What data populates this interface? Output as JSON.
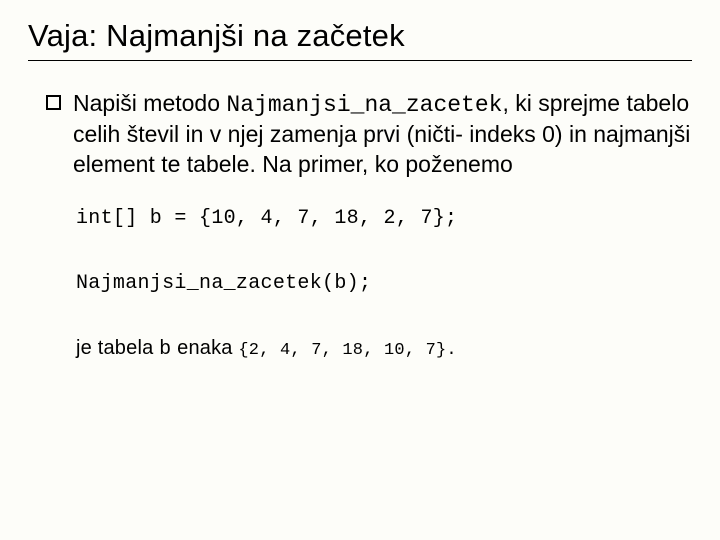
{
  "title": "Vaja: Najmanjši na začetek",
  "bullet": {
    "prefix": "Napiši metodo ",
    "method_name": "Najmanjsi_na_zacetek",
    "suffix": ", ki sprejme tabelo celih števil in v njej zamenja prvi (ničti- indeks 0) in najmanjši element te tabele. Na primer, ko poženemo"
  },
  "code_decl": "int[] b = {10, 4, 7, 18, 2, 7};",
  "code_call": "Najmanjsi_na_zacetek(b);",
  "final": {
    "prefix": "je tabela ",
    "var": "b",
    "mid": " enaka ",
    "result": "{2, 4, 7, 18, 10, 7}."
  }
}
